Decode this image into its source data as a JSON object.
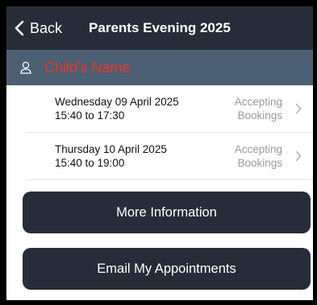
{
  "navbar": {
    "back_label": "Back",
    "title": "Parents Evening 2025"
  },
  "child": {
    "name": "Child's Name",
    "icon": "person-icon",
    "name_color": "#e8372f"
  },
  "sessions": [
    {
      "date": "Wednesday 09 April 2025",
      "time": "15:40 to 17:30",
      "status_line1": "Accepting",
      "status_line2": "Bookings"
    },
    {
      "date": "Thursday 10 April 2025",
      "time": "15:40 to 19:00",
      "status_line1": "Accepting",
      "status_line2": "Bookings"
    }
  ],
  "buttons": {
    "more_info": "More Information",
    "email": "Email My Appointments"
  },
  "colors": {
    "navbar": "#262d38",
    "child_bar": "#4c5f73",
    "button": "#262d38"
  }
}
